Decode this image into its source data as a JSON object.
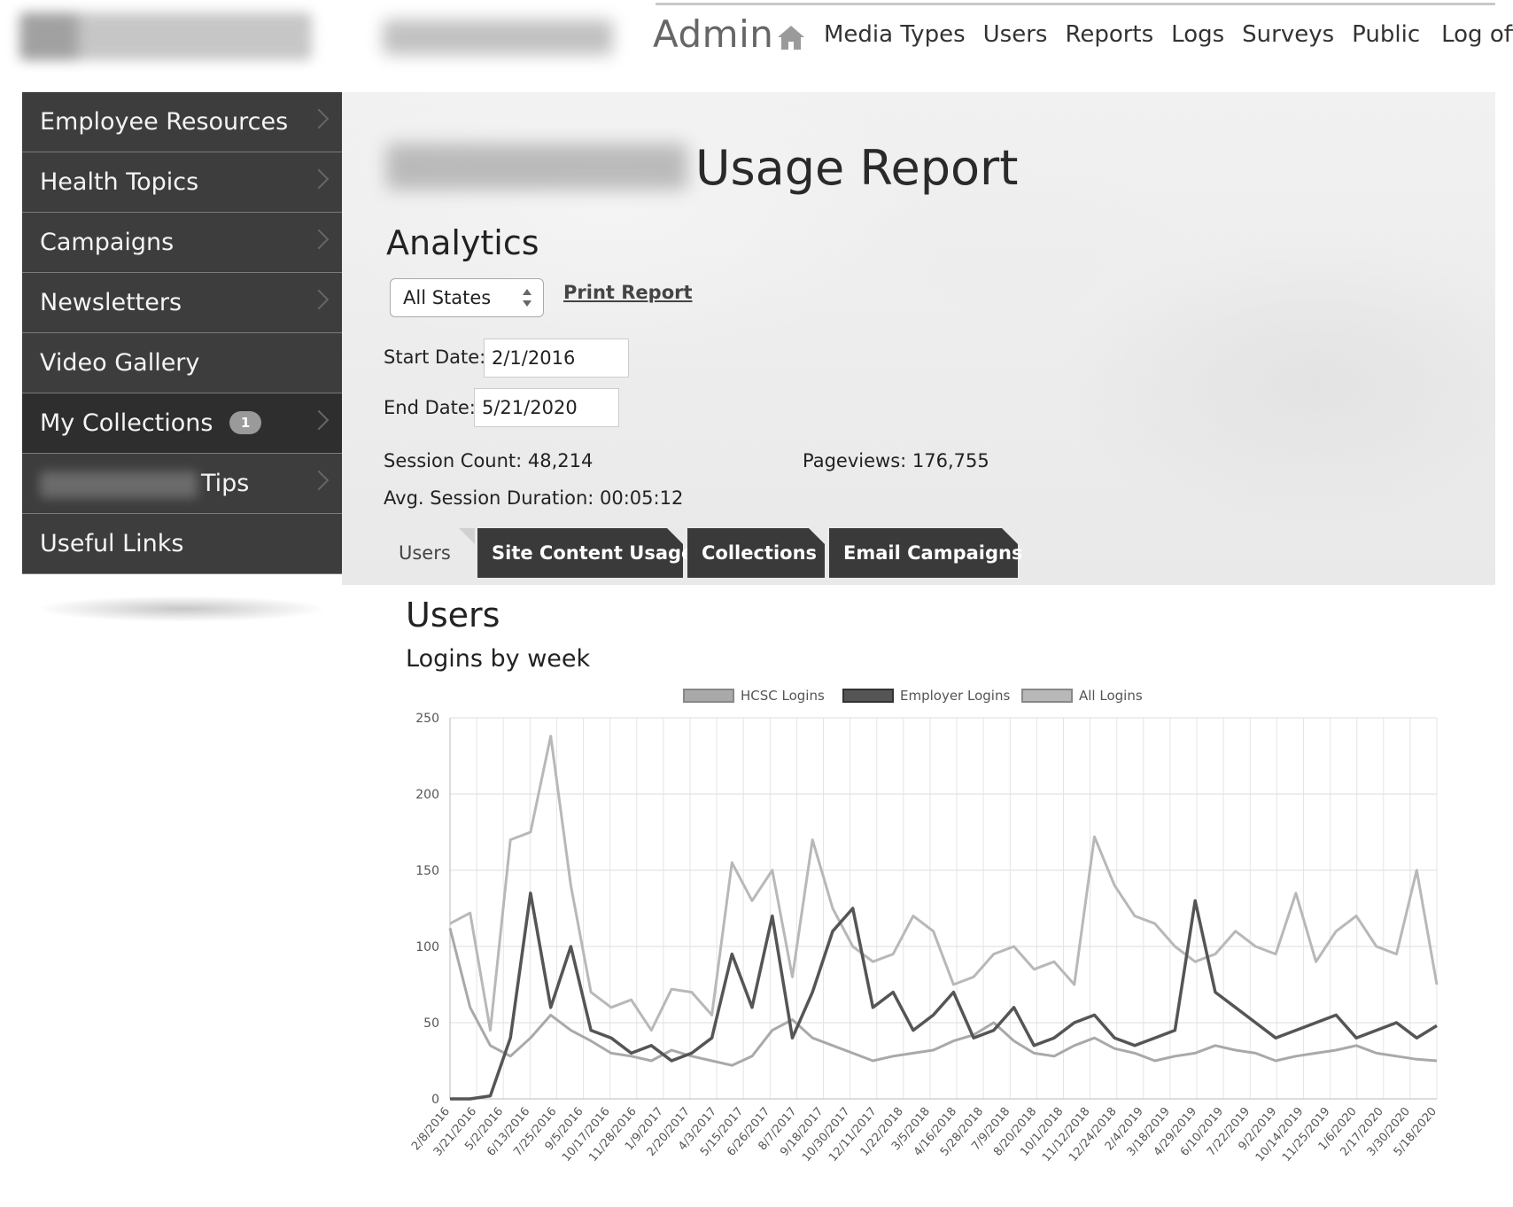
{
  "header": {
    "admin_title": "Admin",
    "nav": [
      "Media Types",
      "Users",
      "Reports",
      "Logs",
      "Surveys",
      "Public",
      "Log off"
    ]
  },
  "sidebar": {
    "items": [
      {
        "label": "Employee Resources"
      },
      {
        "label": "Health Topics"
      },
      {
        "label": "Campaigns"
      },
      {
        "label": "Newsletters"
      },
      {
        "label": "Video Gallery"
      },
      {
        "label": "My Collections",
        "badge": "1"
      },
      {
        "label": "Tips"
      },
      {
        "label": "Useful Links"
      }
    ]
  },
  "report": {
    "title": "Usage Report",
    "section": "Analytics",
    "state_select": "All States",
    "print_label": "Print Report",
    "start_label": "Start Date:",
    "start_value": "2/1/2016",
    "end_label": "End Date:",
    "end_value": "5/21/2020",
    "session_count": "Session Count: 48,214",
    "pageviews": "Pageviews: 176,755",
    "avg_duration": "Avg. Session Duration: 00:05:12"
  },
  "tabs": [
    "Users",
    "Site Content Usage",
    "Collections",
    "Email Campaigns"
  ],
  "users": {
    "heading": "Users",
    "subheading": "Logins by week"
  },
  "colors": {
    "sidebar_bg": "#3d3d3d",
    "tab_bg": "#3a3a3a",
    "hcsc": "#a9a9a9",
    "employer": "#555555",
    "all": "#b8b8b8"
  },
  "chart_data": {
    "type": "line",
    "ylim": [
      0,
      250
    ],
    "yticks": [
      0,
      50,
      100,
      150,
      200,
      250
    ],
    "grid": true,
    "legend_position": "top",
    "x_tick_labels": [
      "2/8/2016",
      "3/21/2016",
      "5/2/2016",
      "6/13/2016",
      "7/25/2016",
      "9/5/2016",
      "10/17/2016",
      "11/28/2016",
      "1/9/2017",
      "2/20/2017",
      "4/3/2017",
      "5/15/2017",
      "6/26/2017",
      "8/7/2017",
      "9/18/2017",
      "10/30/2017",
      "12/11/2017",
      "1/22/2018",
      "3/5/2018",
      "4/16/2018",
      "5/28/2018",
      "7/9/2018",
      "8/20/2018",
      "10/1/2018",
      "11/12/2018",
      "12/24/2018",
      "2/4/2019",
      "3/18/2019",
      "4/29/2019",
      "6/10/2019",
      "7/22/2019",
      "9/2/2019",
      "10/14/2019",
      "11/25/2019",
      "1/6/2020",
      "2/17/2020",
      "3/30/2020",
      "5/18/2020"
    ],
    "series": [
      {
        "name": "HCSC Logins",
        "values": [
          112,
          60,
          35,
          28,
          40,
          55,
          45,
          38,
          30,
          28,
          25,
          32,
          28,
          25,
          22,
          28,
          45,
          52,
          40,
          35,
          30,
          25,
          28,
          30,
          32,
          38,
          42,
          50,
          38,
          30,
          28,
          35,
          40,
          33,
          30,
          25,
          28,
          30,
          35,
          32,
          30,
          25,
          28,
          30,
          32,
          35,
          30,
          28,
          26,
          25
        ]
      },
      {
        "name": "Employer Logins",
        "values": [
          0,
          0,
          2,
          40,
          135,
          60,
          100,
          45,
          40,
          30,
          35,
          25,
          30,
          40,
          95,
          60,
          120,
          40,
          70,
          110,
          125,
          60,
          70,
          45,
          55,
          70,
          40,
          45,
          60,
          35,
          40,
          50,
          55,
          40,
          35,
          40,
          45,
          130,
          70,
          60,
          50,
          40,
          45,
          50,
          55,
          40,
          45,
          50,
          40,
          48
        ]
      },
      {
        "name": "All Logins",
        "values": [
          115,
          122,
          45,
          170,
          175,
          238,
          140,
          70,
          60,
          65,
          45,
          72,
          70,
          55,
          155,
          130,
          150,
          80,
          170,
          125,
          100,
          90,
          95,
          120,
          110,
          75,
          80,
          95,
          100,
          85,
          90,
          75,
          172,
          140,
          120,
          115,
          100,
          90,
          95,
          110,
          100,
          95,
          135,
          90,
          110,
          120,
          100,
          95,
          150,
          75
        ]
      }
    ]
  }
}
